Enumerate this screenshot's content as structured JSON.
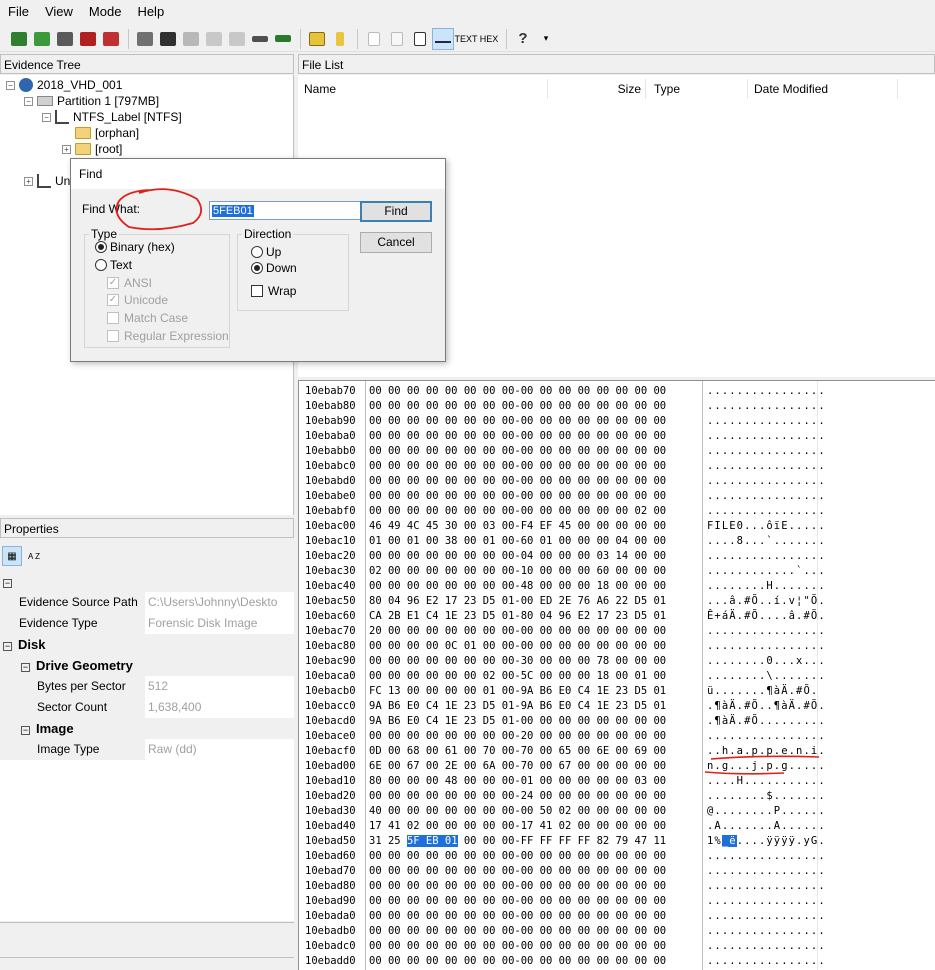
{
  "menu": [
    "File",
    "View",
    "Mode",
    "Help"
  ],
  "toolbar": {
    "text_button": "TEXT",
    "hex_button": "HEX",
    "help_glyph": "?"
  },
  "evidence_tree": {
    "title": "Evidence Tree",
    "nodes": [
      {
        "label": "2018_VHD_001"
      },
      {
        "label": "Partition 1 [797MB]"
      },
      {
        "label": "NTFS_Label [NTFS]"
      },
      {
        "label": "[orphan]"
      },
      {
        "label": "[root]"
      },
      {
        "label": "Un"
      }
    ]
  },
  "file_list": {
    "title": "File List",
    "columns": [
      "Name",
      "Size",
      "Type",
      "Date Modified"
    ]
  },
  "properties": {
    "title": "Properties",
    "sort_label": "A Z",
    "rows": [
      {
        "key": "Evidence Source Path",
        "value": "C:\\Users\\Johnny\\Deskto"
      },
      {
        "key": "Evidence Type",
        "value": "Forensic Disk Image"
      }
    ],
    "disk_label": "Disk",
    "drive_geometry_label": "Drive Geometry",
    "geometry": [
      {
        "key": "Bytes per Sector",
        "value": "512"
      },
      {
        "key": "Sector Count",
        "value": "1,638,400"
      }
    ],
    "image_label": "Image",
    "image_rows": [
      {
        "key": "Image Type",
        "value": "Raw (dd)"
      }
    ]
  },
  "find_dialog": {
    "title": "Find",
    "find_what_label": "Find What:",
    "find_what_value": "5FEB01",
    "find_button": "Find",
    "cancel_button": "Cancel",
    "type_group": "Type",
    "type_binary": "Binary (hex)",
    "type_text": "Text",
    "ansi": "ANSI",
    "unicode": "Unicode",
    "match_case": "Match Case",
    "regex": "Regular Expression",
    "direction_group": "Direction",
    "up": "Up",
    "down": "Down",
    "wrap": "Wrap"
  },
  "hex_view": {
    "rows": [
      {
        "addr": "10ebab70",
        "hex": "00 00 00 00 00 00 00 00-00 00 00 00 00 00 00 00",
        "ascii": "................"
      },
      {
        "addr": "10ebab80",
        "hex": "00 00 00 00 00 00 00 00-00 00 00 00 00 00 00 00",
        "ascii": "................"
      },
      {
        "addr": "10ebab90",
        "hex": "00 00 00 00 00 00 00 00-00 00 00 00 00 00 00 00",
        "ascii": "................"
      },
      {
        "addr": "10ebaba0",
        "hex": "00 00 00 00 00 00 00 00-00 00 00 00 00 00 00 00",
        "ascii": "................"
      },
      {
        "addr": "10ebabb0",
        "hex": "00 00 00 00 00 00 00 00-00 00 00 00 00 00 00 00",
        "ascii": "................"
      },
      {
        "addr": "10ebabc0",
        "hex": "00 00 00 00 00 00 00 00-00 00 00 00 00 00 00 00",
        "ascii": "................"
      },
      {
        "addr": "10ebabd0",
        "hex": "00 00 00 00 00 00 00 00-00 00 00 00 00 00 00 00",
        "ascii": "................"
      },
      {
        "addr": "10ebabe0",
        "hex": "00 00 00 00 00 00 00 00-00 00 00 00 00 00 00 00",
        "ascii": "................"
      },
      {
        "addr": "10ebabf0",
        "hex": "00 00 00 00 00 00 00 00-00 00 00 00 00 00 02 00",
        "ascii": "................"
      },
      {
        "addr": "10ebac00",
        "hex": "46 49 4C 45 30 00 03 00-F4 EF 45 00 00 00 00 00",
        "ascii": "FILE0...ôïE....."
      },
      {
        "addr": "10ebac10",
        "hex": "01 00 01 00 38 00 01 00-60 01 00 00 00 04 00 00",
        "ascii": "....8...`......."
      },
      {
        "addr": "10ebac20",
        "hex": "00 00 00 00 00 00 00 00-04 00 00 00 03 14 00 00",
        "ascii": "................"
      },
      {
        "addr": "10ebac30",
        "hex": "02 00 00 00 00 00 00 00-10 00 00 00 60 00 00 00",
        "ascii": "............`..."
      },
      {
        "addr": "10ebac40",
        "hex": "00 00 00 00 00 00 00 00-48 00 00 00 18 00 00 00",
        "ascii": "........H......."
      },
      {
        "addr": "10ebac50",
        "hex": "80 04 96 E2 17 23 D5 01-00 ED 2E 76 A6 22 D5 01",
        "ascii": "...â.#Õ..í.v¦\"Õ."
      },
      {
        "addr": "10ebac60",
        "hex": "CA 2B E1 C4 1E 23 D5 01-80 04 96 E2 17 23 D5 01",
        "ascii": "Ê+áÄ.#Õ....â.#Õ."
      },
      {
        "addr": "10ebac70",
        "hex": "20 00 00 00 00 00 00 00-00 00 00 00 00 00 00 00",
        "ascii": "................"
      },
      {
        "addr": "10ebac80",
        "hex": "00 00 00 00 0C 01 00 00-00 00 00 00 00 00 00 00",
        "ascii": "................"
      },
      {
        "addr": "10ebac90",
        "hex": "00 00 00 00 00 00 00 00-30 00 00 00 78 00 00 00",
        "ascii": "........0...x..."
      },
      {
        "addr": "10ebaca0",
        "hex": "00 00 00 00 00 00 02 00-5C 00 00 00 18 00 01 00",
        "ascii": "........\\......."
      },
      {
        "addr": "10ebacb0",
        "hex": "FC 13 00 00 00 00 01 00-9A B6 E0 C4 1E 23 D5 01",
        "ascii": "ü.......¶àÄ.#Õ."
      },
      {
        "addr": "10ebacc0",
        "hex": "9A B6 E0 C4 1E 23 D5 01-9A B6 E0 C4 1E 23 D5 01",
        "ascii": ".¶àÄ.#Õ..¶àÄ.#Õ."
      },
      {
        "addr": "10ebacd0",
        "hex": "9A B6 E0 C4 1E 23 D5 01-00 00 00 00 00 00 00 00",
        "ascii": ".¶àÄ.#Õ........."
      },
      {
        "addr": "10ebace0",
        "hex": "00 00 00 00 00 00 00 00-20 00 00 00 00 00 00 00",
        "ascii": "................"
      },
      {
        "addr": "10ebacf0",
        "hex": "0D 00 68 00 61 00 70 00-70 00 65 00 6E 00 69 00",
        "ascii": "..h.a.p.p.e.n.i."
      },
      {
        "addr": "10ebad00",
        "hex": "6E 00 67 00 2E 00 6A 00-70 00 67 00 00 00 00 00",
        "ascii": "n.g...j.p.g....."
      },
      {
        "addr": "10ebad10",
        "hex": "80 00 00 00 48 00 00 00-01 00 00 00 00 00 03 00",
        "ascii": "....H..........."
      },
      {
        "addr": "10ebad20",
        "hex": "00 00 00 00 00 00 00 00-24 00 00 00 00 00 00 00",
        "ascii": "........$......."
      },
      {
        "addr": "10ebad30",
        "hex": "40 00 00 00 00 00 00 00-00 50 02 00 00 00 00 00",
        "ascii": "@........P......"
      },
      {
        "addr": "10ebad40",
        "hex": "17 41 02 00 00 00 00 00-17 41 02 00 00 00 00 00",
        "ascii": ".A.......A......"
      },
      {
        "addr": "10ebad50",
        "hex": "31 25 5F EB 01 00 00 00-FF FF FF FF 82 79 47 11",
        "ascii": "1%_ë....ÿÿÿÿ.yG."
      },
      {
        "addr": "10ebad60",
        "hex": "00 00 00 00 00 00 00 00-00 00 00 00 00 00 00 00",
        "ascii": "................"
      },
      {
        "addr": "10ebad70",
        "hex": "00 00 00 00 00 00 00 00-00 00 00 00 00 00 00 00",
        "ascii": "................"
      },
      {
        "addr": "10ebad80",
        "hex": "00 00 00 00 00 00 00 00-00 00 00 00 00 00 00 00",
        "ascii": "................"
      },
      {
        "addr": "10ebad90",
        "hex": "00 00 00 00 00 00 00 00-00 00 00 00 00 00 00 00",
        "ascii": "................"
      },
      {
        "addr": "10ebada0",
        "hex": "00 00 00 00 00 00 00 00-00 00 00 00 00 00 00 00",
        "ascii": "................"
      },
      {
        "addr": "10ebadb0",
        "hex": "00 00 00 00 00 00 00 00-00 00 00 00 00 00 00 00",
        "ascii": "................"
      },
      {
        "addr": "10ebadc0",
        "hex": "00 00 00 00 00 00 00 00-00 00 00 00 00 00 00 00",
        "ascii": "................"
      },
      {
        "addr": "10ebadd0",
        "hex": "00 00 00 00 00 00 00 00-00 00 00 00 00 00 00 00",
        "ascii": "................"
      }
    ],
    "selected_hex": "5F EB 01",
    "selected_ascii": "_ë"
  },
  "colors": {
    "selection": "#1e6fd9",
    "annotation": "#e0201a"
  }
}
